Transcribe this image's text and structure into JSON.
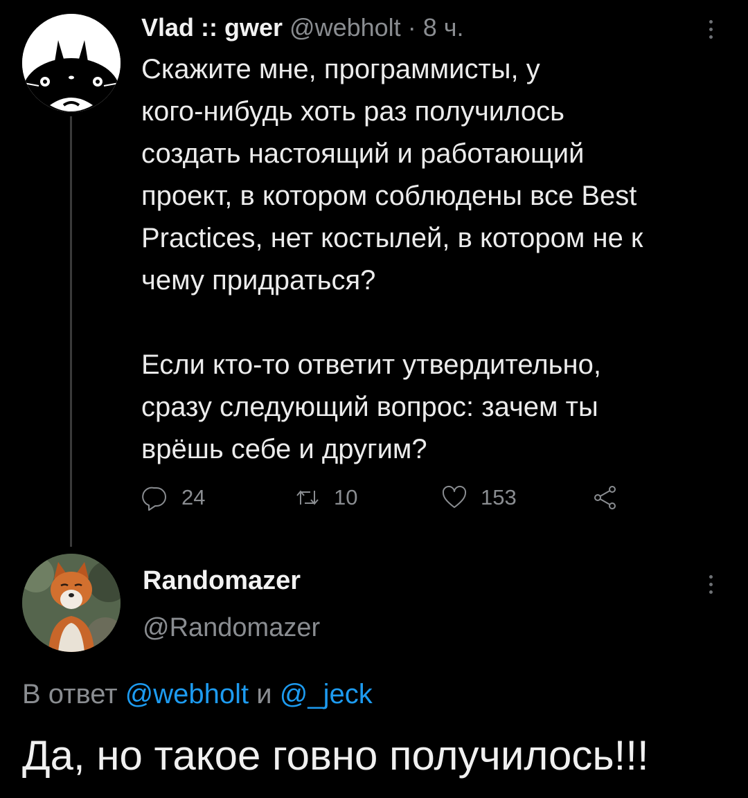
{
  "tweet": {
    "author_name": "Vlad :: gwer",
    "author_handle": "@webholt",
    "separator": "·",
    "time": "8 ч.",
    "paragraphs": [
      "Скажите мне, программисты, у\nкого-нибудь хоть раз получилось\nсоздать настоящий и работающий\nпроект, в котором соблюдены все Best\nPractices, нет костылей, в котором не к\nчему придраться?",
      "Если кто-то ответит утвердительно,\nсразу следующий вопрос: зачем ты\nврёшь себе и другим?"
    ],
    "actions": {
      "replies": "24",
      "retweets": "10",
      "likes": "153"
    }
  },
  "reply": {
    "author_name": "Randomazer",
    "author_handle": "@Randomazer",
    "reply_prefix": "В ответ",
    "mention_1": "@webholt",
    "conjunction": "и",
    "mention_2": "@_jeck",
    "text": "Да, но такое говно получилось!!!"
  },
  "icons": [
    "more-vertical-icon",
    "reply-icon",
    "retweet-icon",
    "like-icon",
    "share-icon"
  ],
  "colors": {
    "background": "#000000",
    "text": "#ececec",
    "secondary": "#8a8d91",
    "link": "#1d9bf0",
    "thread_line": "#3a3a3a"
  }
}
